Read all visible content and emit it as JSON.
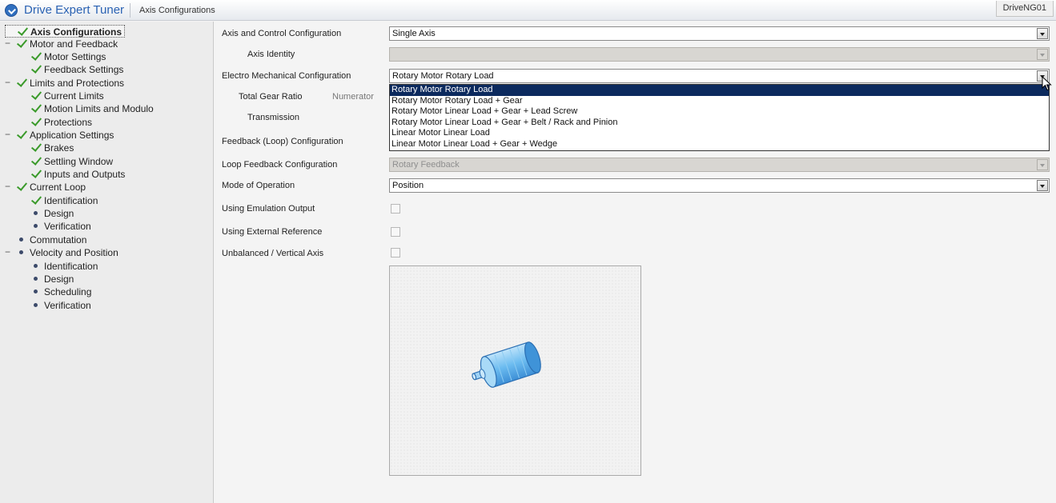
{
  "header": {
    "app_title": "Drive Expert Tuner",
    "breadcrumb": "Axis Configurations",
    "drive_name": "DriveNG01"
  },
  "sidebar": {
    "items": [
      {
        "label": "Axis Configurations",
        "status": "check",
        "selected": true
      },
      {
        "label": "Motor and Feedback",
        "status": "check",
        "collapsible": true
      },
      {
        "label": "Motor Settings",
        "status": "check"
      },
      {
        "label": "Feedback Settings",
        "status": "check"
      },
      {
        "label": "Limits and Protections",
        "status": "check",
        "collapsible": true
      },
      {
        "label": "Current Limits",
        "status": "check"
      },
      {
        "label": "Motion Limits and Modulo",
        "status": "check"
      },
      {
        "label": "Protections",
        "status": "check"
      },
      {
        "label": "Application Settings",
        "status": "check",
        "collapsible": true
      },
      {
        "label": "Brakes",
        "status": "check"
      },
      {
        "label": "Settling Window",
        "status": "check"
      },
      {
        "label": "Inputs and Outputs",
        "status": "check"
      },
      {
        "label": "Current Loop",
        "status": "check",
        "collapsible": true
      },
      {
        "label": "Identification",
        "status": "check"
      },
      {
        "label": "Design",
        "status": "dot"
      },
      {
        "label": "Verification",
        "status": "dot"
      },
      {
        "label": "Commutation",
        "status": "dot"
      },
      {
        "label": "Velocity and Position",
        "status": "dot",
        "collapsible": true
      },
      {
        "label": "Identification",
        "status": "dot"
      },
      {
        "label": "Design",
        "status": "dot"
      },
      {
        "label": "Scheduling",
        "status": "dot"
      },
      {
        "label": "Verification",
        "status": "dot"
      }
    ]
  },
  "form": {
    "axis_control_label": "Axis and Control Configuration",
    "axis_control_value": "Single Axis",
    "axis_identity_label": "Axis Identity",
    "axis_identity_value": "",
    "electro_mech_label": "Electro Mechanical Configuration",
    "electro_mech_value": "Rotary Motor Rotary Load",
    "electro_mech_options": [
      "Rotary Motor Rotary Load",
      "Rotary Motor Rotary Load + Gear",
      "Rotary Motor Linear Load + Gear + Lead Screw",
      "Rotary Motor Linear Load + Gear + Belt / Rack and Pinion",
      "Linear Motor Linear Load",
      "Linear Motor Linear Load + Gear + Wedge"
    ],
    "total_gear_ratio_label": "Total Gear Ratio",
    "numerator_label": "Numerator",
    "transmission_label": "Transmission",
    "feedback_loop_label": "Feedback (Loop) Configuration",
    "loop_feedback_label": "Loop Feedback Configuration",
    "loop_feedback_value": "Rotary Feedback",
    "mode_label": "Mode of Operation",
    "mode_value": "Position",
    "emulation_label": "Using Emulation Output",
    "external_ref_label": "Using External Reference",
    "unbalanced_label": "Unbalanced / Vertical Axis"
  },
  "icons": {
    "app": "app-logo-icon",
    "check": "checkmark-icon",
    "dot": "bullet-dot-icon",
    "motor": "rotary-motor-icon",
    "cursor": "mouse-pointer-icon"
  },
  "colors": {
    "accent": "#2a62b3",
    "check_green": "#3a9a2a",
    "highlight": "#0c2a5e",
    "motor_blue": "#4aa8e8"
  }
}
